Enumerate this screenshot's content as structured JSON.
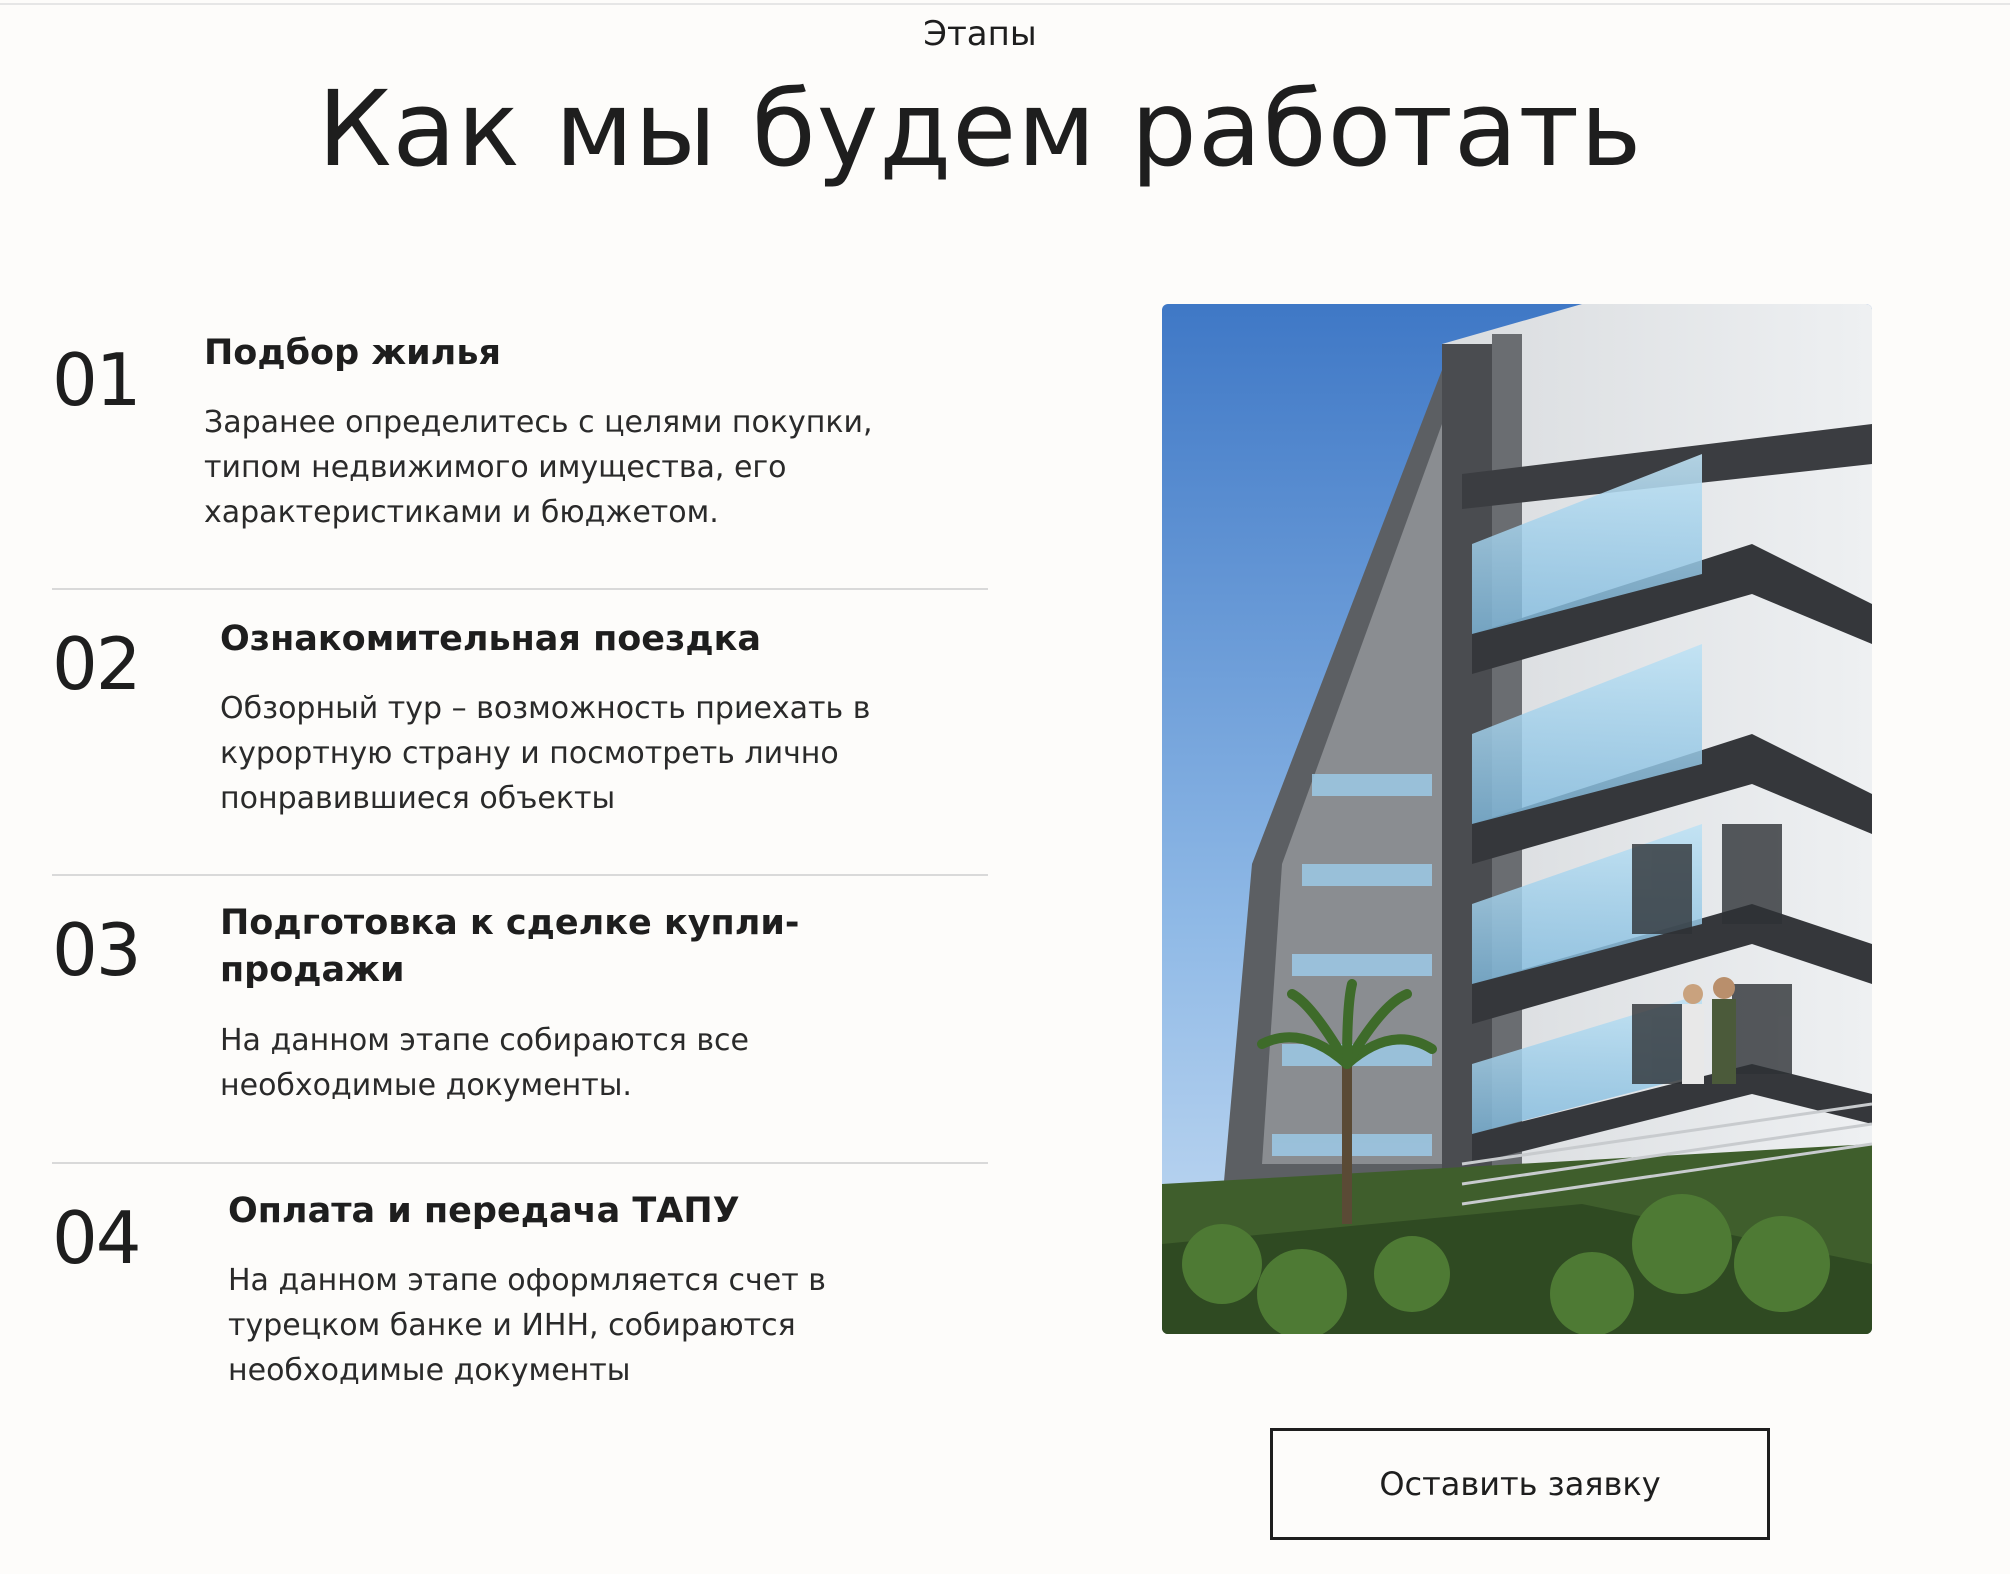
{
  "header": {
    "eyebrow": "Этапы",
    "title": "Как мы будем работать"
  },
  "steps": [
    {
      "number": "01",
      "title": "Подбор жилья",
      "lines": [
        "Заранее определитесь с целями покупки,",
        "типом недвижимого имущества, его",
        "характеристиками и бюджетом."
      ]
    },
    {
      "number": "02",
      "title": "Ознакомительная поездка",
      "lines": [
        "Обзорный тур – возможность приехать в",
        "курортную страну и посмотреть лично",
        "понравившиеся объекты"
      ]
    },
    {
      "number": "03",
      "title_lines": [
        "Подготовка к сделке купли-",
        "продажи"
      ],
      "lines": [
        "На данном этапе собираются все",
        "необходимые документы."
      ]
    },
    {
      "number": "04",
      "title": "Оплата и передача ТАПУ",
      "lines": [
        "На данном этапе оформляется счет в",
        "турецком банке и ИНН, собираются",
        "необходимые документы"
      ]
    }
  ],
  "photo": {
    "subject": "modern apartment building illustration"
  },
  "cta": {
    "label": "Оставить заявку"
  }
}
